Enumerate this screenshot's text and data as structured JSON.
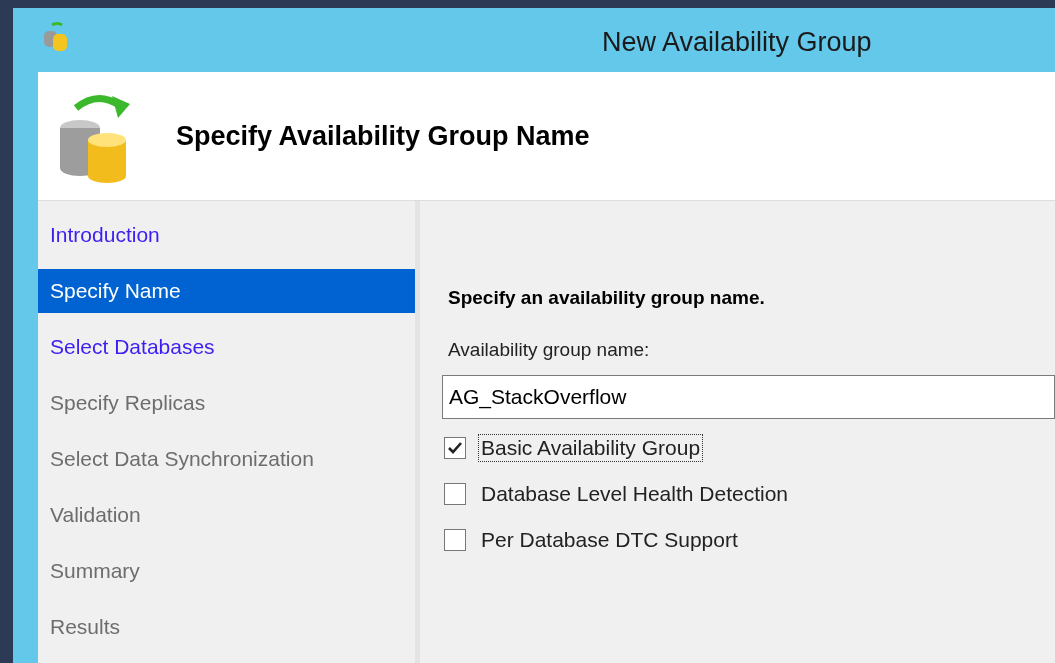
{
  "window": {
    "title": "New Availability Group"
  },
  "header": {
    "title": "Specify Availability Group Name"
  },
  "nav": {
    "items": [
      {
        "label": "Introduction",
        "selected": false,
        "enabled": true
      },
      {
        "label": "Specify Name",
        "selected": true,
        "enabled": true
      },
      {
        "label": "Select Databases",
        "selected": false,
        "enabled": true
      },
      {
        "label": "Specify Replicas",
        "selected": false,
        "enabled": false
      },
      {
        "label": "Select Data Synchronization",
        "selected": false,
        "enabled": false
      },
      {
        "label": "Validation",
        "selected": false,
        "enabled": false
      },
      {
        "label": "Summary",
        "selected": false,
        "enabled": false
      },
      {
        "label": "Results",
        "selected": false,
        "enabled": false
      }
    ]
  },
  "content": {
    "heading": "Specify an availability group name.",
    "name_label": "Availability group name:",
    "name_value": "AG_StackOverflow",
    "options": [
      {
        "label": "Basic Availability Group",
        "checked": true,
        "focused": true
      },
      {
        "label": "Database Level Health Detection",
        "checked": false,
        "focused": false
      },
      {
        "label": "Per Database DTC Support",
        "checked": false,
        "focused": false
      }
    ]
  }
}
